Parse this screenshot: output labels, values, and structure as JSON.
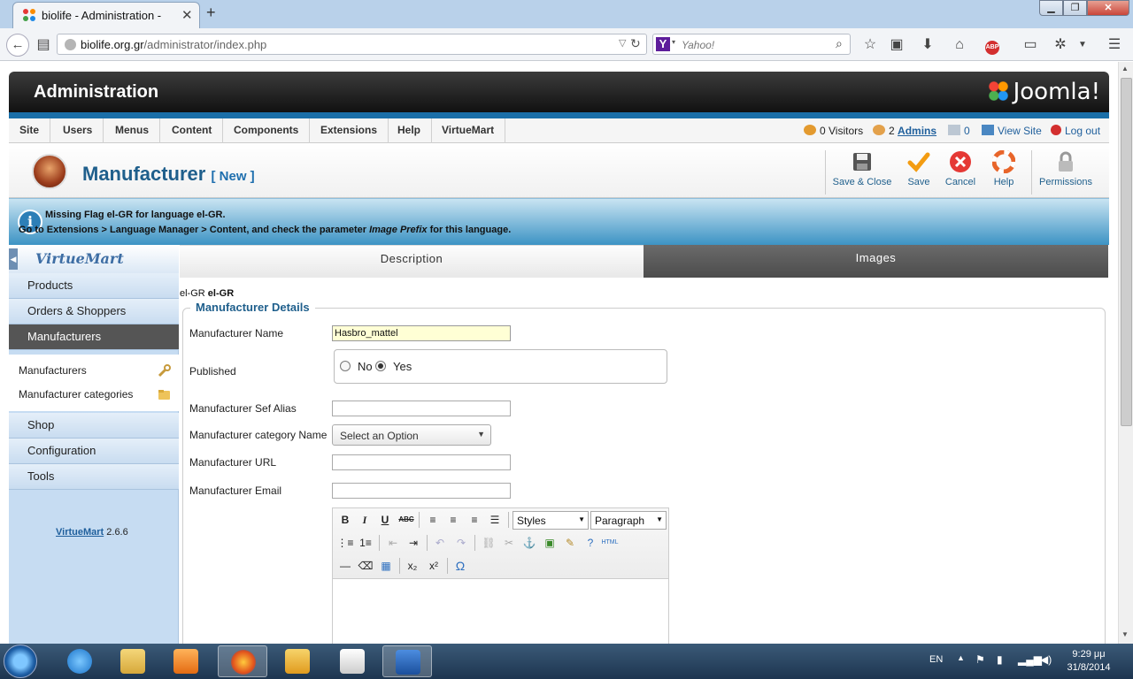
{
  "browser": {
    "tab_title": "biolife - Administration -",
    "url_host": "biolife.org.gr",
    "url_path": "/administrator/index.php",
    "search_placeholder": "Yahoo!",
    "search_engine_letter": "Y"
  },
  "header": {
    "title": "Administration",
    "logo_text": "Joomla!"
  },
  "menu": {
    "items": [
      "Site",
      "Users",
      "Menus",
      "Content",
      "Components",
      "Extensions",
      "Help",
      "VirtueMart"
    ],
    "visitors": "0 Visitors",
    "admins_count": "2",
    "admins_label": "Admins",
    "messages": "0",
    "view_site": "View Site",
    "logout": "Log out"
  },
  "toolbar": {
    "page_title": "Manufacturer",
    "page_subtitle": "[ New ]",
    "save_close": "Save & Close",
    "save": "Save",
    "cancel": "Cancel",
    "help": "Help",
    "permissions": "Permissions"
  },
  "message": {
    "line1": "Missing Flag el-GR for language el-GR.",
    "line2_a": "Go to Extensions > Language Manager > Content, and check the parameter ",
    "line2_em": "Image Prefix",
    "line2_b": " for this language."
  },
  "sidebar": {
    "logo": "VirtueMart",
    "items": [
      "Products",
      "Orders & Shoppers",
      "Manufacturers",
      "Shop",
      "Configuration",
      "Tools"
    ],
    "sub_items": [
      "Manufacturers",
      "Manufacturer categories"
    ],
    "version_link": "VirtueMart",
    "version_num": "2.6.6"
  },
  "tabs": {
    "description": "Description",
    "images": "Images"
  },
  "lang": {
    "code": "el-GR",
    "code_bold": "el-GR"
  },
  "form": {
    "legend": "Manufacturer Details",
    "name_label": "Manufacturer Name",
    "name_value": "Hasbro_mattel",
    "published_label": "Published",
    "no_label": "No",
    "yes_label": "Yes",
    "published_value": "Yes",
    "sef_label": "Manufacturer Sef Alias",
    "sef_value": "",
    "category_label": "Manufacturer category Name",
    "category_value": "Select an Option",
    "url_label": "Manufacturer URL",
    "url_value": "",
    "email_label": "Manufacturer Email",
    "email_value": ""
  },
  "editor": {
    "styles": "Styles",
    "paragraph": "Paragraph",
    "html_label": "HTML"
  },
  "taskbar": {
    "lang": "EN",
    "time": "9:29 μμ",
    "date": "31/8/2014"
  }
}
